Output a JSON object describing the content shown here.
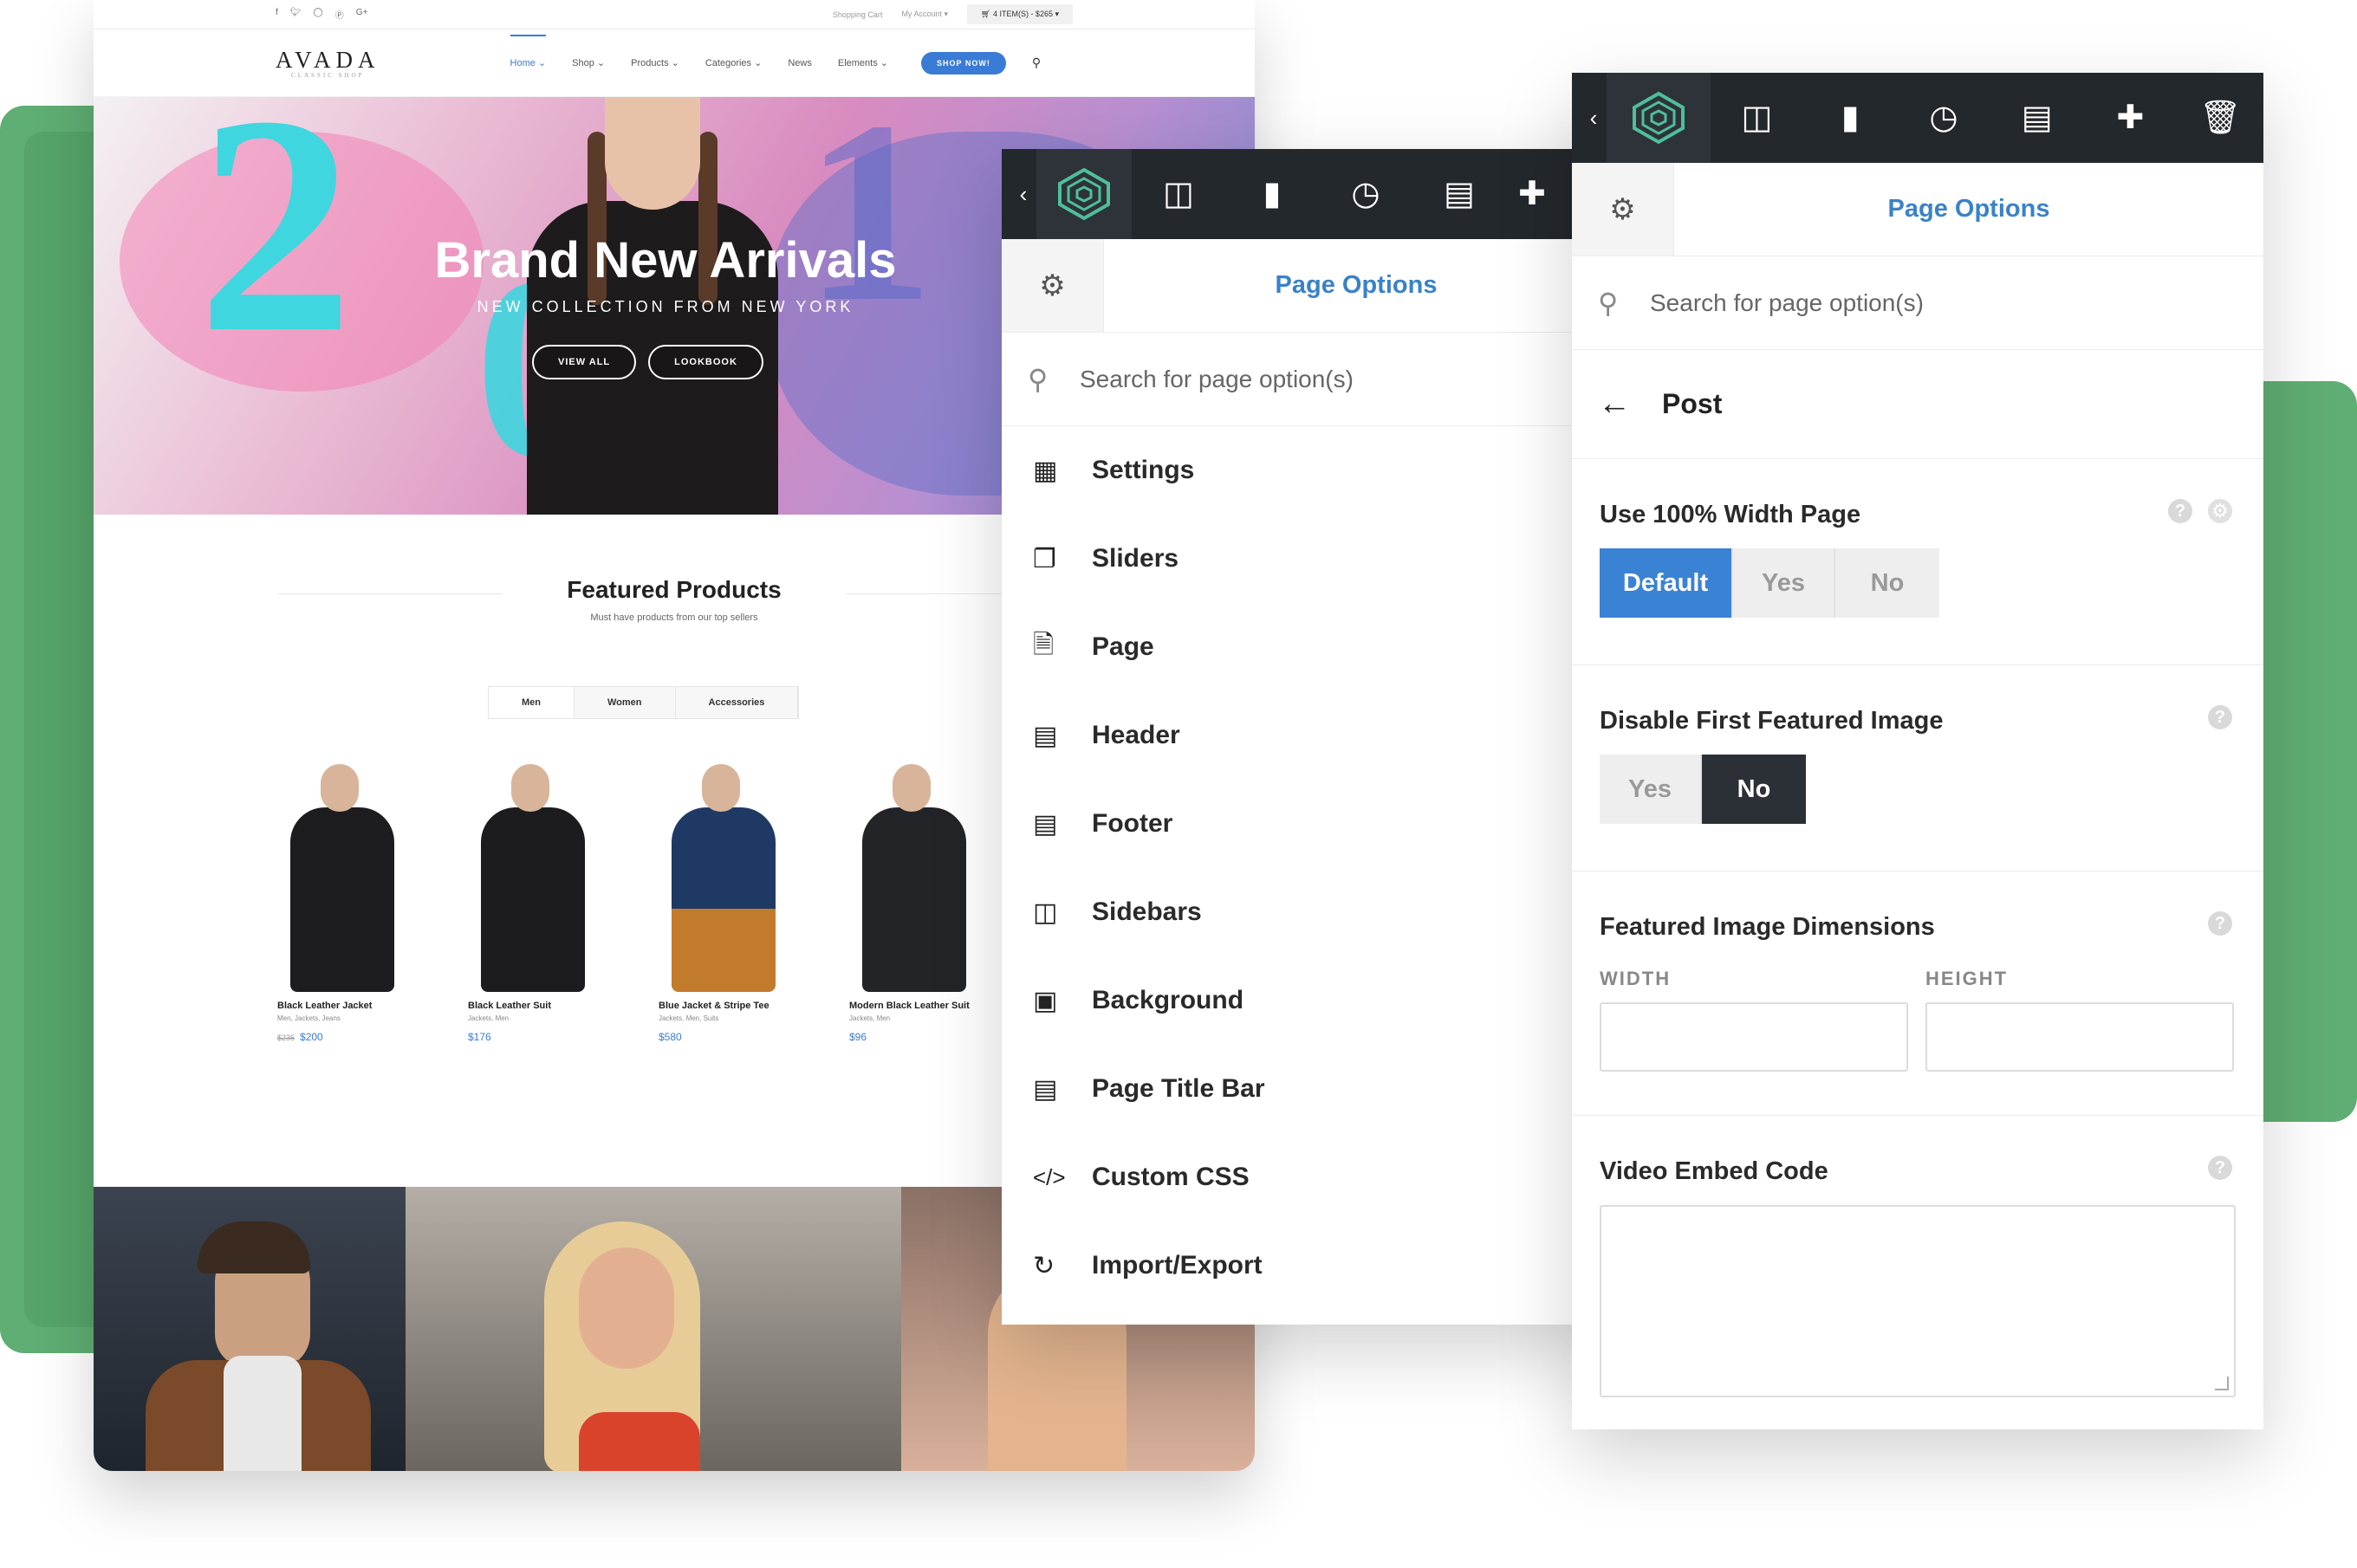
{
  "site": {
    "social_icons": [
      "facebook-icon",
      "twitter-icon",
      "instagram-icon",
      "pinterest-icon",
      "google-plus-icon"
    ],
    "topbar": {
      "cart_link": "Shopping Cart",
      "account_link": "My Account",
      "cart_summary": "4 ITEM(S) - $265"
    },
    "logo": {
      "name": "AVADA",
      "tagline": "CLASSIC SHOP"
    },
    "nav": [
      "Home",
      "Shop",
      "Products",
      "Categories",
      "News",
      "Elements"
    ],
    "shop_button": "SHOP NOW!",
    "hero": {
      "title": "Brand New Arrivals",
      "subtitle": "NEW COLLECTION FROM NEW YORK",
      "btn_view_all": "VIEW ALL",
      "btn_lookbook": "LOOKBOOK"
    },
    "featured": {
      "title": "Featured Products",
      "subtitle": "Must have products from our top sellers"
    },
    "tabs": [
      "Men",
      "Women",
      "Accessories"
    ],
    "products": [
      {
        "name": "Black Leather Jacket",
        "cats": "Men, Jackets, Jeans",
        "old_price": "$235",
        "price": "$200"
      },
      {
        "name": "Black Leather Suit",
        "cats": "Jackets, Men",
        "old_price": "",
        "price": "$176"
      },
      {
        "name": "Blue Jacket & Stripe Tee",
        "cats": "Jackets, Men, Suits",
        "old_price": "",
        "price": "$580"
      },
      {
        "name": "Modern Black Leather Suit",
        "cats": "Jackets, Men",
        "old_price": "",
        "price": "$96"
      }
    ]
  },
  "panel_left": {
    "title": "Page Options",
    "search_placeholder": "Search for page option(s)",
    "items": [
      {
        "label": "Settings",
        "icon": "settings-list-icon"
      },
      {
        "label": "Sliders",
        "icon": "sliders-icon"
      },
      {
        "label": "Page",
        "icon": "page-icon"
      },
      {
        "label": "Header",
        "icon": "header-icon"
      },
      {
        "label": "Footer",
        "icon": "footer-icon"
      },
      {
        "label": "Sidebars",
        "icon": "sidebars-icon"
      },
      {
        "label": "Background",
        "icon": "background-icon"
      },
      {
        "label": "Page Title Bar",
        "icon": "page-title-bar-icon"
      },
      {
        "label": "Custom CSS",
        "icon": "code-icon"
      },
      {
        "label": "Import/Export",
        "icon": "import-export-icon"
      }
    ]
  },
  "panel_right": {
    "title": "Page Options",
    "search_placeholder": "Search for page option(s)",
    "section": "Post",
    "width_option": {
      "label": "Use 100% Width Page",
      "choices": [
        "Default",
        "Yes",
        "No"
      ],
      "selected": "Default"
    },
    "featured_option": {
      "label": "Disable First Featured Image",
      "choices": [
        "Yes",
        "No"
      ],
      "selected": "No"
    },
    "dimensions": {
      "label": "Featured Image Dimensions",
      "width_label": "WIDTH",
      "height_label": "HEIGHT",
      "width_value": "",
      "height_value": ""
    },
    "video": {
      "label": "Video Embed Code",
      "value": ""
    }
  },
  "colors": {
    "accent": "#3a82d4",
    "toolbar": "#23282d",
    "green": "#5fae73"
  }
}
